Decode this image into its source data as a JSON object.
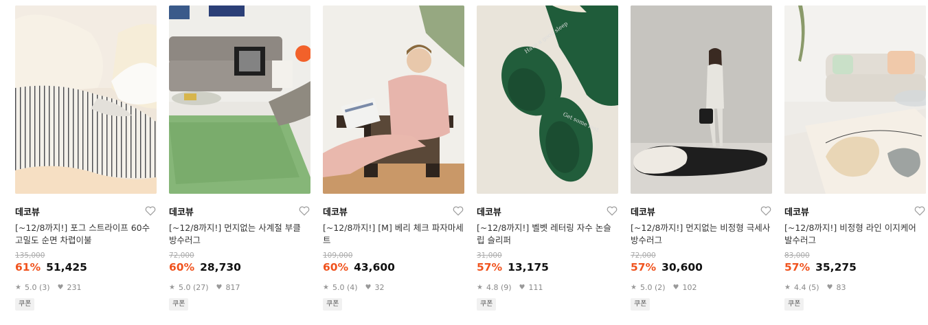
{
  "products": [
    {
      "brand": "데코뷰",
      "title": "[~12/8까지!] 포그 스트라이프 60수 고밀도 순면 차렵이불",
      "original_price": "135,000",
      "discount": "61%",
      "price": "51,425",
      "rating": "5.0 (3)",
      "likes": "231",
      "badge": "쿠폰"
    },
    {
      "brand": "데코뷰",
      "title": "[~12/8까지!] 먼지없는 사계절 부클 방수러그",
      "original_price": "72,000",
      "discount": "60%",
      "price": "28,730",
      "rating": "5.0 (27)",
      "likes": "817",
      "badge": "쿠폰"
    },
    {
      "brand": "데코뷰",
      "title": "[~12/8까지!] [M] 베리 체크 파자마세트",
      "original_price": "109,000",
      "discount": "60%",
      "price": "43,600",
      "rating": "5.0 (4)",
      "likes": "32",
      "badge": "쿠폰"
    },
    {
      "brand": "데코뷰",
      "title": "[~12/8까지!] 벨벳 레터링 자수 논슬립 슬리퍼",
      "original_price": "31,000",
      "discount": "57%",
      "price": "13,175",
      "rating": "4.8 (9)",
      "likes": "111",
      "badge": "쿠폰"
    },
    {
      "brand": "데코뷰",
      "title": "[~12/8까지!] 먼지없는 비정형 극세사 방수러그",
      "original_price": "72,000",
      "discount": "57%",
      "price": "30,600",
      "rating": "5.0 (2)",
      "likes": "102",
      "badge": "쿠폰"
    },
    {
      "brand": "데코뷰",
      "title": "[~12/8까지!] 비정형 라인 이지케어 발수러그",
      "original_price": "83,000",
      "discount": "57%",
      "price": "35,275",
      "rating": "4.4 (5)",
      "likes": "83",
      "badge": "쿠폰"
    }
  ],
  "slipper_embroidery": [
    "Have a good sleep",
    "Get some rest"
  ],
  "icons": {
    "like": "heart-outline-icon",
    "rating": "star-icon",
    "likes": "heart-filled-icon"
  },
  "colors": {
    "discount": "#f0531e",
    "price": "#111111",
    "muted": "#888888"
  }
}
